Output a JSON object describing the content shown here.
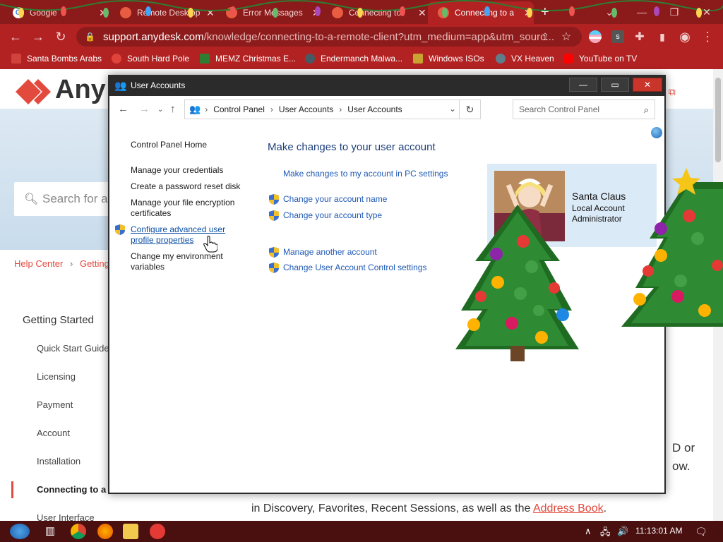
{
  "browser": {
    "tabs": [
      {
        "title": "Google",
        "color": "#4285f4"
      },
      {
        "title": "Remote Desktop",
        "color": "#e85c41"
      },
      {
        "title": "Error Messages",
        "color": "#e85c41"
      },
      {
        "title": "Connecting to",
        "color": "#e85c41"
      },
      {
        "title": "Connecting to a",
        "color": "#e85c41"
      }
    ],
    "address": {
      "host": "support.anydesk.com",
      "path": "/knowledge/connecting-to-a-remote-client?utm_medium=app&utm_sourc..."
    },
    "bookmarks": [
      {
        "label": "Santa Bombs Arabs",
        "icon_color": "#d0423b"
      },
      {
        "label": "South Hard Pole",
        "icon_color": "#e0433a"
      },
      {
        "label": "MEMZ Christmas E...",
        "icon_color": "#2e7d32"
      },
      {
        "label": "Endermanch Malwa...",
        "icon_color": "#455a64"
      },
      {
        "label": "Windows ISOs",
        "icon_color": "#c8a32f"
      },
      {
        "label": "VX Heaven",
        "icon_color": "#607d8b"
      },
      {
        "label": "YouTube on TV",
        "icon_color": "#ff0000"
      }
    ]
  },
  "website": {
    "logo": "Any",
    "search_placeholder": "Search for a",
    "breadcrumb": {
      "home": "Help Center",
      "current": "Getting"
    },
    "contact": "us",
    "section_title": "Getting Started",
    "nav": [
      "Quick Start Guide",
      "Licensing",
      "Payment",
      "Account",
      "Installation",
      "Connecting to a R",
      "User Interface"
    ],
    "frag_right_1": "D or",
    "frag_right_2": "ow.",
    "para_line": "in Discovery, Favorites, Recent Sessions, as well as the ",
    "para_link": "Address Book",
    "para_end": "."
  },
  "window": {
    "title": "User Accounts",
    "breadcrumb": [
      "Control Panel",
      "User Accounts",
      "User Accounts"
    ],
    "search_placeholder": "Search Control Panel",
    "left_links": {
      "home": "Control Panel Home",
      "credentials": "Manage your credentials",
      "reset_disk": "Create a password reset disk",
      "encryption_1": "Manage your file encryption",
      "encryption_2": "certificates",
      "profile_1": "Configure advanced user",
      "profile_2": "profile properties",
      "env_1": "Change my environment",
      "env_2": "variables"
    },
    "main": {
      "title": "Make changes to your user account",
      "pc_settings": "Make changes to my account in PC settings",
      "change_name": "Change your account name",
      "change_type": "Change your account type",
      "manage_other": "Manage another account",
      "uac": "Change User Account Control settings"
    },
    "user": {
      "name": "Santa Claus",
      "account": "Local Account",
      "role": "Administrator"
    }
  },
  "taskbar": {
    "clock": "11:13:01 AM"
  },
  "colors": {
    "chrome_dark": "#8b1a1a",
    "chrome": "#b22222",
    "link": "#1e58b4",
    "accent": "#e34a3e"
  }
}
